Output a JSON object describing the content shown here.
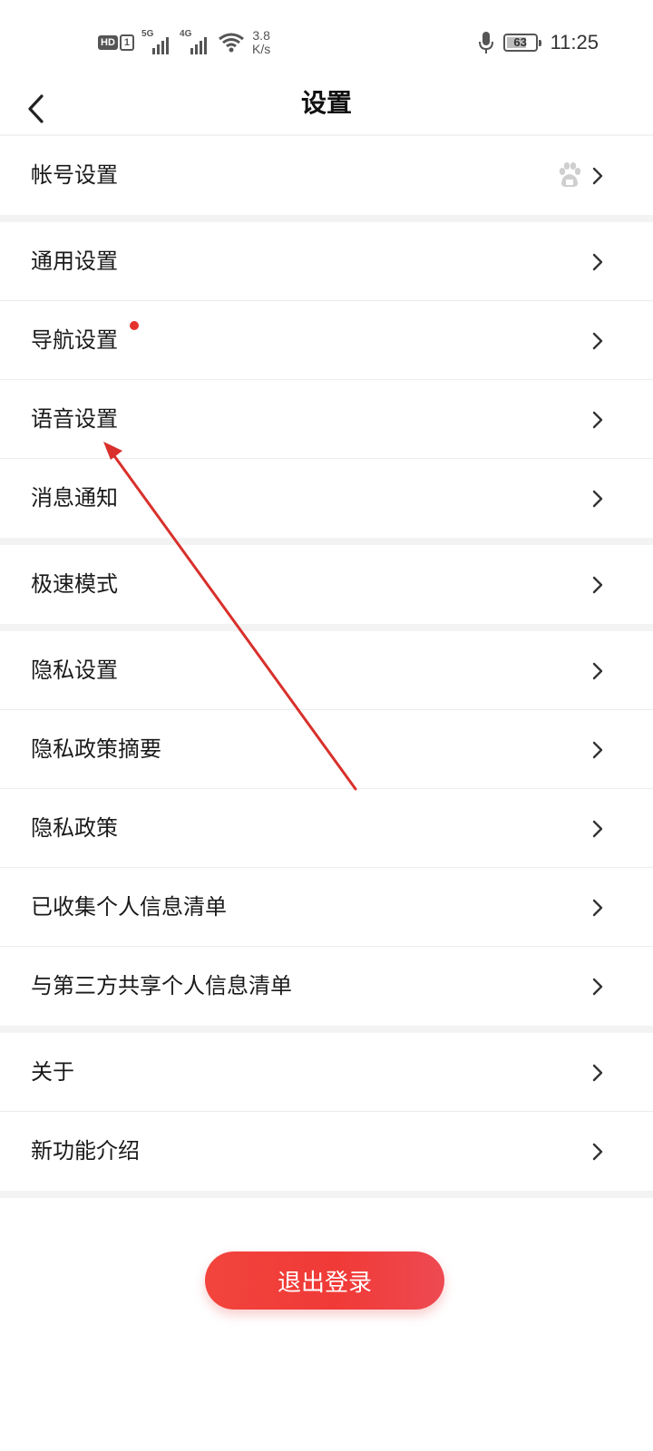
{
  "status_bar": {
    "hd_label": "HD",
    "sim_label": "1",
    "sig1_gen": "5G",
    "sig2_gen": "4G",
    "speed_value": "3.8",
    "speed_unit": "K/s",
    "battery_level": "63",
    "time": "11:25"
  },
  "header": {
    "title": "设置",
    "back_icon": "chevron-left-icon"
  },
  "settings": {
    "account": "帐号设置",
    "general": "通用设置",
    "navigation": "导航设置",
    "voice": "语音设置",
    "notifications": "消息通知",
    "speed_mode": "极速模式",
    "privacy_settings": "隐私设置",
    "privacy_summary": "隐私政策摘要",
    "privacy_policy": "隐私政策",
    "collected_info": "已收集个人信息清单",
    "shared_info": "与第三方共享个人信息清单",
    "about": "关于",
    "new_features": "新功能介绍"
  },
  "logout_label": "退出登录",
  "colors": {
    "accent": "#f2443d",
    "badge_dot": "#e5322d",
    "annotation_arrow": "#d9302b",
    "section_gap": "#f3f3f3"
  }
}
